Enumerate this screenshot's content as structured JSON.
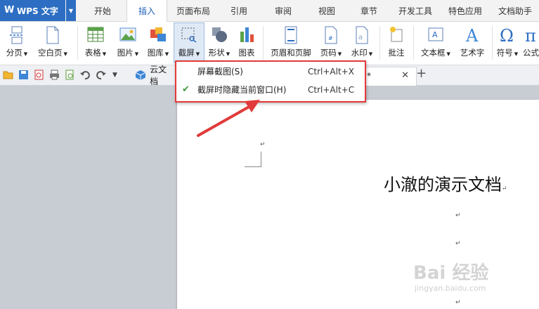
{
  "app": {
    "title": "WPS 文字"
  },
  "menu": {
    "tabs": [
      {
        "label": "开始"
      },
      {
        "label": "插入"
      },
      {
        "label": "页面布局"
      },
      {
        "label": "引用"
      },
      {
        "label": "审阅"
      },
      {
        "label": "视图"
      },
      {
        "label": "章节"
      },
      {
        "label": "开发工具"
      },
      {
        "label": "特色应用"
      },
      {
        "label": "文档助手"
      }
    ],
    "active": "插入"
  },
  "ribbon": {
    "page_break": "分页",
    "blank_page": "空白页",
    "table": "表格",
    "picture": "图片",
    "gallery": "图库",
    "screenshot": "截屏",
    "shapes": "形状",
    "chart": "图表",
    "header_footer": "页眉和页脚",
    "page_number": "页码",
    "watermark": "水印",
    "comment": "批注",
    "text_box": "文本框",
    "word_art": "艺术字",
    "symbol": "符号",
    "formula": "公式"
  },
  "tabs": {
    "cloud_docs": "云文档",
    "current_doc_star": "*"
  },
  "dropdown": {
    "items": [
      {
        "label": "屏幕截图(S)",
        "shortcut": "Ctrl+Alt+X",
        "checked": false
      },
      {
        "label": "截屏时隐藏当前窗口(H)",
        "shortcut": "Ctrl+Alt+C",
        "checked": true
      }
    ]
  },
  "document": {
    "title": "小澈的演示文档",
    "para_mark": "↵"
  },
  "watermark": {
    "brand": "Bai 经验",
    "url": "jingyan.baidu.com"
  },
  "colors": {
    "accent": "#2d6ec3",
    "annotation_red": "#e23a3a"
  }
}
